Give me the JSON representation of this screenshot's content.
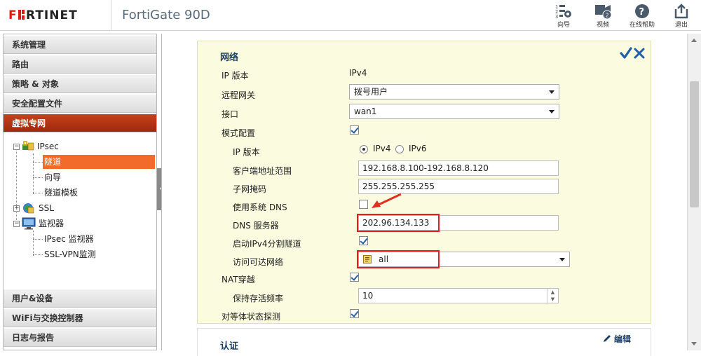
{
  "header": {
    "brand": "FORTINET",
    "title": "FortiGate 90D",
    "tools": [
      {
        "label": "向导",
        "icon": "wizard-icon"
      },
      {
        "label": "视频",
        "icon": "video-icon"
      },
      {
        "label": "在线帮助",
        "icon": "help-icon"
      },
      {
        "label": "退出",
        "icon": "logout-icon"
      }
    ]
  },
  "sidebar": {
    "top_items": [
      "系统管理",
      "路由",
      "策略 & 对象",
      "安全配置文件",
      "虚拟专网"
    ],
    "active": "虚拟专网",
    "tree": {
      "ipsec": "IPsec",
      "ipsec_children": [
        "隧道",
        "向导",
        "隧道模板"
      ],
      "selected": "隧道",
      "ssl": "SSL",
      "monitor": "监视器",
      "monitor_children": [
        "IPsec 监视器",
        "SSL-VPN监测"
      ]
    },
    "bottom_items": [
      "用户&设备",
      "WiFi与交换控制器",
      "日志与报告"
    ]
  },
  "form": {
    "section_title": "网络",
    "ip_version_label": "IP 版本",
    "ip_version_value": "IPv4",
    "remote_gateway_label": "远程网关",
    "remote_gateway_value": "拨号用户",
    "interface_label": "接口",
    "interface_value": "wan1",
    "mode_config_label": "模式配置",
    "sub_ip_version_label": "IP 版本",
    "ipv4_option": "IPv4",
    "ipv6_option": "IPv6",
    "client_range_label": "客户端地址范围",
    "client_range_value": "192.168.8.100-192.168.8.120",
    "subnet_mask_label": "子网掩码",
    "subnet_mask_value": "255.255.255.255",
    "use_system_dns_label": "使用系统 DNS",
    "dns_server_label": "DNS 服务器",
    "dns_server_value": "202.96.134.133",
    "split_tunnel_label": "启动IPv4分割隧道",
    "accessible_network_label": "访问可达网络",
    "accessible_network_value": "all",
    "nat_traversal_label": "NAT穿越",
    "keepalive_label": "保持存活频率",
    "keepalive_value": "10",
    "dpd_label": "对等体状态探测"
  },
  "auth_section": {
    "title": "认证",
    "edit_label": "编辑"
  },
  "colors": {
    "active_menu": "#b33414",
    "selected_tree": "#f26b2a",
    "panel_bg": "#fbfbdf",
    "highlight_box": "#e02020",
    "title_blue": "#1c3f66"
  }
}
